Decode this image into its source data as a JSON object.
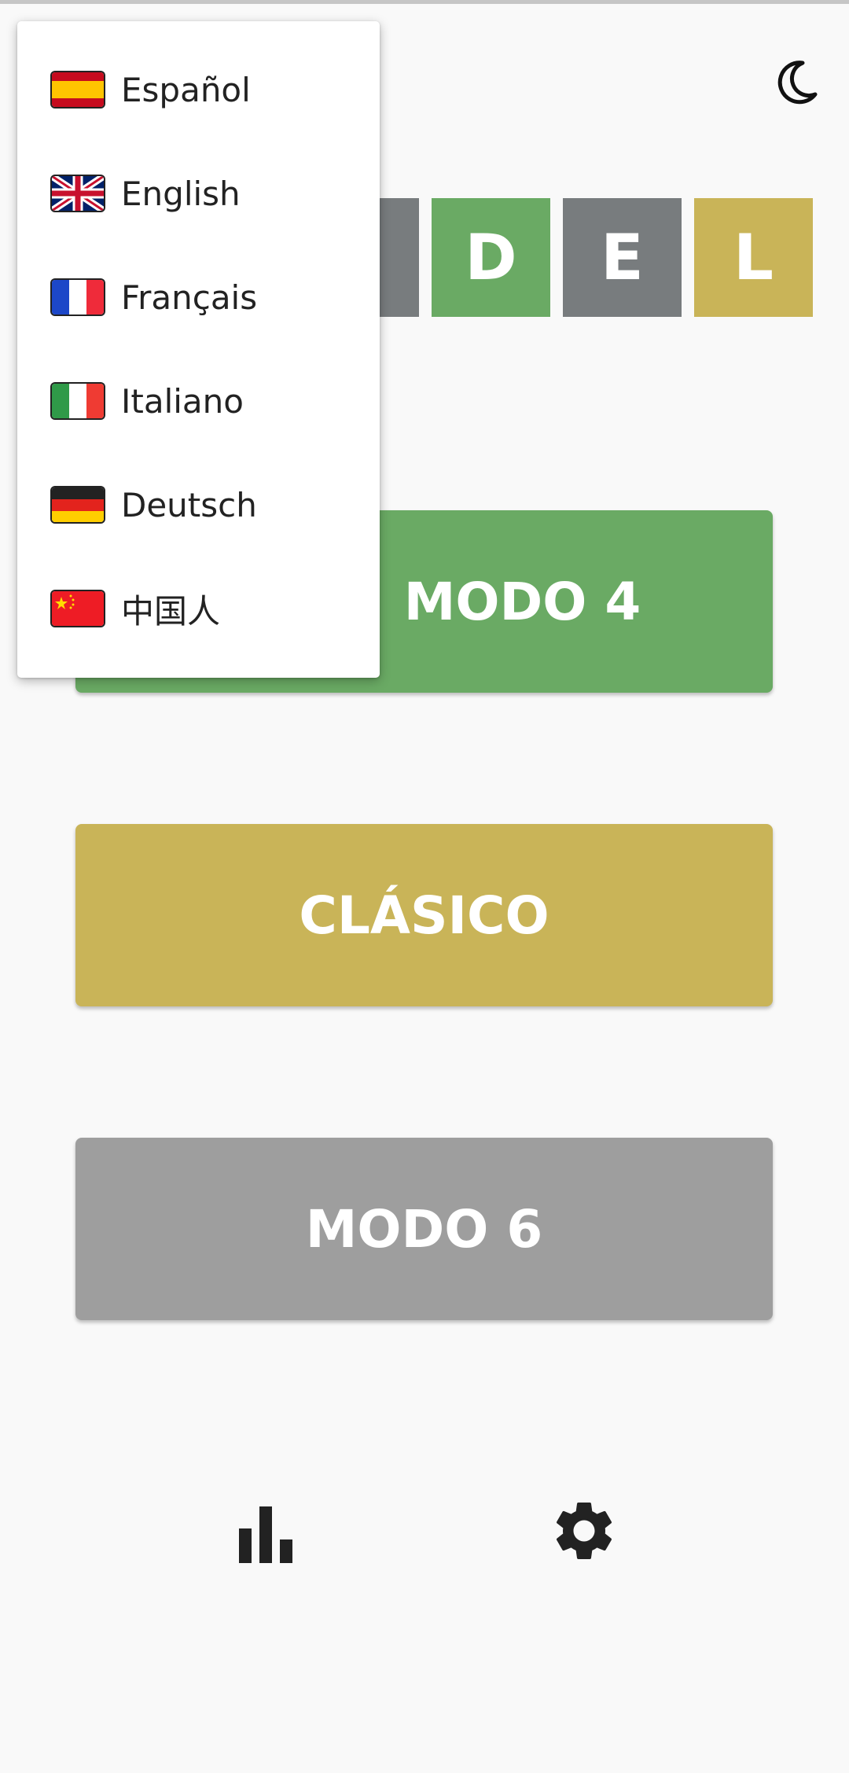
{
  "header": {
    "theme_toggle_icon": "moon-icon"
  },
  "title_tiles": [
    {
      "letter": "",
      "color": "#787c7e"
    },
    {
      "letter": "D",
      "color": "#6aaa64"
    },
    {
      "letter": "E",
      "color": "#787c7e"
    },
    {
      "letter": "L",
      "color": "#c9b458"
    }
  ],
  "modes": {
    "mode4_label": "MODO 4",
    "classic_label": "CLÁSICO",
    "mode6_label": "MODO 6"
  },
  "colors": {
    "green": "#6aaa64",
    "yellow": "#c9b458",
    "gray": "#9e9e9e",
    "tile_gray": "#787c7e"
  },
  "bottom_nav": {
    "stats_icon": "bar-chart-icon",
    "settings_icon": "gear-icon"
  },
  "language_menu": {
    "items": [
      {
        "label": "Español",
        "flag": "spain-flag-icon"
      },
      {
        "label": "English",
        "flag": "uk-flag-icon"
      },
      {
        "label": "Français",
        "flag": "france-flag-icon"
      },
      {
        "label": "Italiano",
        "flag": "italy-flag-icon"
      },
      {
        "label": "Deutsch",
        "flag": "germany-flag-icon"
      },
      {
        "label": "中国人",
        "flag": "china-flag-icon"
      }
    ]
  }
}
